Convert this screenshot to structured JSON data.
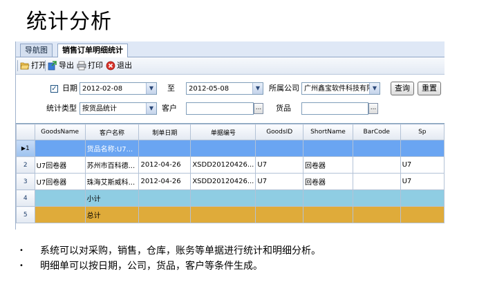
{
  "slide": {
    "title": "统计分析",
    "bullets": [
      "系统可以对采购，销售，仓库，账务等单据进行统计和明细分析。",
      "明细单可以按日期，公司，货品，客户等条件生成。"
    ]
  },
  "tabs": [
    {
      "label": "导航图",
      "active": false
    },
    {
      "label": "销售订单明细统计",
      "active": true
    }
  ],
  "toolbar": {
    "open": "打开",
    "export": "导出",
    "print": "打印",
    "exit": "退出"
  },
  "filters": {
    "date_label": "日期",
    "date_checked": true,
    "date_from": "2012-02-08",
    "to_label": "至",
    "date_to": "2012-05-08",
    "company_label": "所属公司",
    "company_value": "广州鑫宝软件科技有限",
    "query_button": "查询",
    "reset_button": "重置",
    "stat_type_label": "统计类型",
    "stat_type_value": "按货品统计",
    "customer_label": "客户",
    "customer_value": "",
    "goods_label": "货品",
    "goods_value": "",
    "browse_glyph": "..."
  },
  "grid": {
    "columns": [
      "GoodsName",
      "客户名称",
      "制单日期",
      "单据编号",
      "GoodsID",
      "ShortName",
      "BarCode",
      "Sp"
    ],
    "rows": [
      {
        "num": "1",
        "marker": "▶",
        "kind": "sel",
        "cells": [
          "",
          "货品名称:U7...",
          "",
          "",
          "",
          "",
          "",
          ""
        ]
      },
      {
        "num": "2",
        "marker": "",
        "kind": "normal",
        "cells": [
          "U7回卷器",
          "苏州市百科德...",
          "2012-04-26",
          "XSDD20120426...",
          "U7",
          "回卷器",
          "",
          "U7"
        ]
      },
      {
        "num": "3",
        "marker": "",
        "kind": "normal",
        "cells": [
          "U7回卷器",
          "珠海艾斯威科...",
          "2012-04-26",
          "XSDD20120426...",
          "U7",
          "回卷器",
          "",
          "U7"
        ]
      },
      {
        "num": "4",
        "marker": "",
        "kind": "sub",
        "cells": [
          "",
          "小计",
          "",
          "",
          "",
          "",
          "",
          ""
        ]
      },
      {
        "num": "5",
        "marker": "",
        "kind": "total",
        "cells": [
          "",
          "总计",
          "",
          "",
          "",
          "",
          "",
          ""
        ]
      }
    ]
  },
  "colors": {
    "selected_row": "#6aa5f2",
    "subtotal_row": "#8fcde3",
    "total_row": "#dfab3a"
  }
}
